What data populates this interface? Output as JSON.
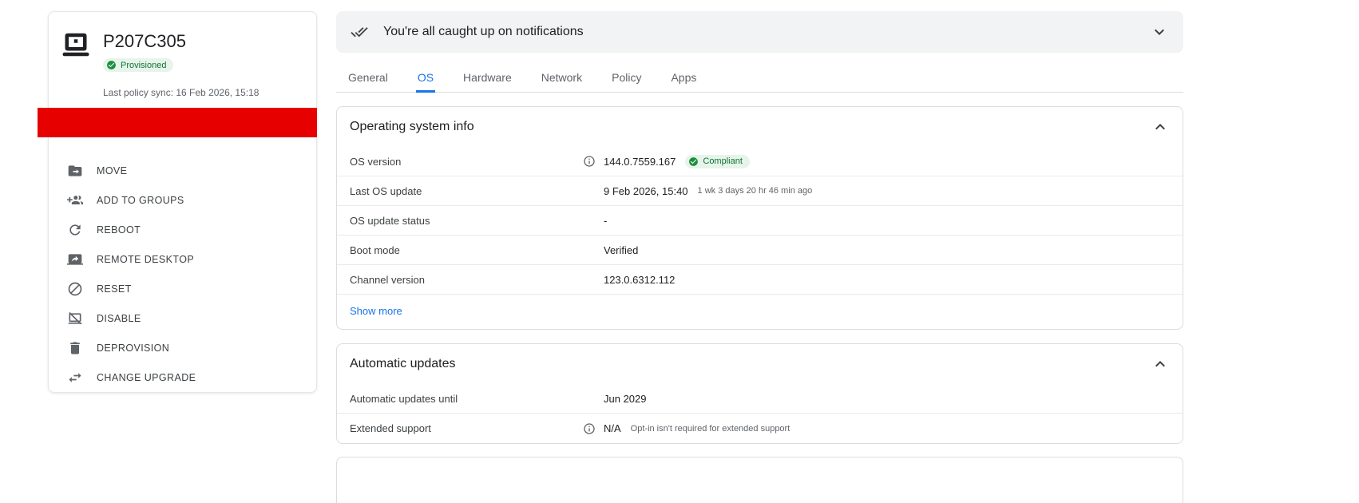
{
  "device": {
    "title": "P207C305",
    "status_badge": "Provisioned",
    "last_policy_sync": "Last policy sync: 16 Feb 2026, 15:18",
    "actions": [
      {
        "label": "MOVE",
        "icon": "drive-file-move-icon"
      },
      {
        "label": "ADD TO GROUPS",
        "icon": "group-add-icon"
      },
      {
        "label": "REBOOT",
        "icon": "refresh-icon"
      },
      {
        "label": "REMOTE DESKTOP",
        "icon": "screen-share-icon"
      },
      {
        "label": "RESET",
        "icon": "block-icon"
      },
      {
        "label": "DISABLE",
        "icon": "laptop-off-icon"
      },
      {
        "label": "DEPROVISION",
        "icon": "trash-icon"
      },
      {
        "label": "CHANGE UPGRADE",
        "icon": "swap-horiz-icon"
      }
    ]
  },
  "notification_bar": {
    "message": "You're all caught up on notifications",
    "icon": "done-all-icon"
  },
  "tabs": [
    {
      "label": "General",
      "active": false
    },
    {
      "label": "OS",
      "active": true
    },
    {
      "label": "Hardware",
      "active": false
    },
    {
      "label": "Network",
      "active": false
    },
    {
      "label": "Policy",
      "active": false
    },
    {
      "label": "Apps",
      "active": false
    }
  ],
  "os_info": {
    "title": "Operating system info",
    "rows": [
      {
        "label": "OS version",
        "value": "144.0.7559.167",
        "badge": "Compliant"
      },
      {
        "label": "Last OS update",
        "value": "9 Feb 2026, 15:40",
        "note": "1 wk 3 days 20 hr 46 min ago"
      },
      {
        "label": "OS update status",
        "value": "-"
      },
      {
        "label": "Boot mode",
        "value": "Verified"
      },
      {
        "label": "Channel version",
        "value": "123.0.6312.112"
      }
    ],
    "show_more_label": "Show more"
  },
  "automatic_updates": {
    "title": "Automatic updates",
    "rows": [
      {
        "label": "Automatic updates until",
        "value": "Jun 2029"
      },
      {
        "label": "Extended support",
        "value": "N/A",
        "note": "Opt-in isn't required for extended support"
      }
    ]
  },
  "colors": {
    "accent_blue": "#1a73e8",
    "badge_green_bg": "#e6f4ea",
    "badge_green_text": "#137333",
    "badge_green_icon": "#1e8e3e",
    "redaction_red": "#e60000",
    "border_gray": "#dadce0",
    "text_primary": "#202124",
    "text_secondary": "#5f6368"
  }
}
